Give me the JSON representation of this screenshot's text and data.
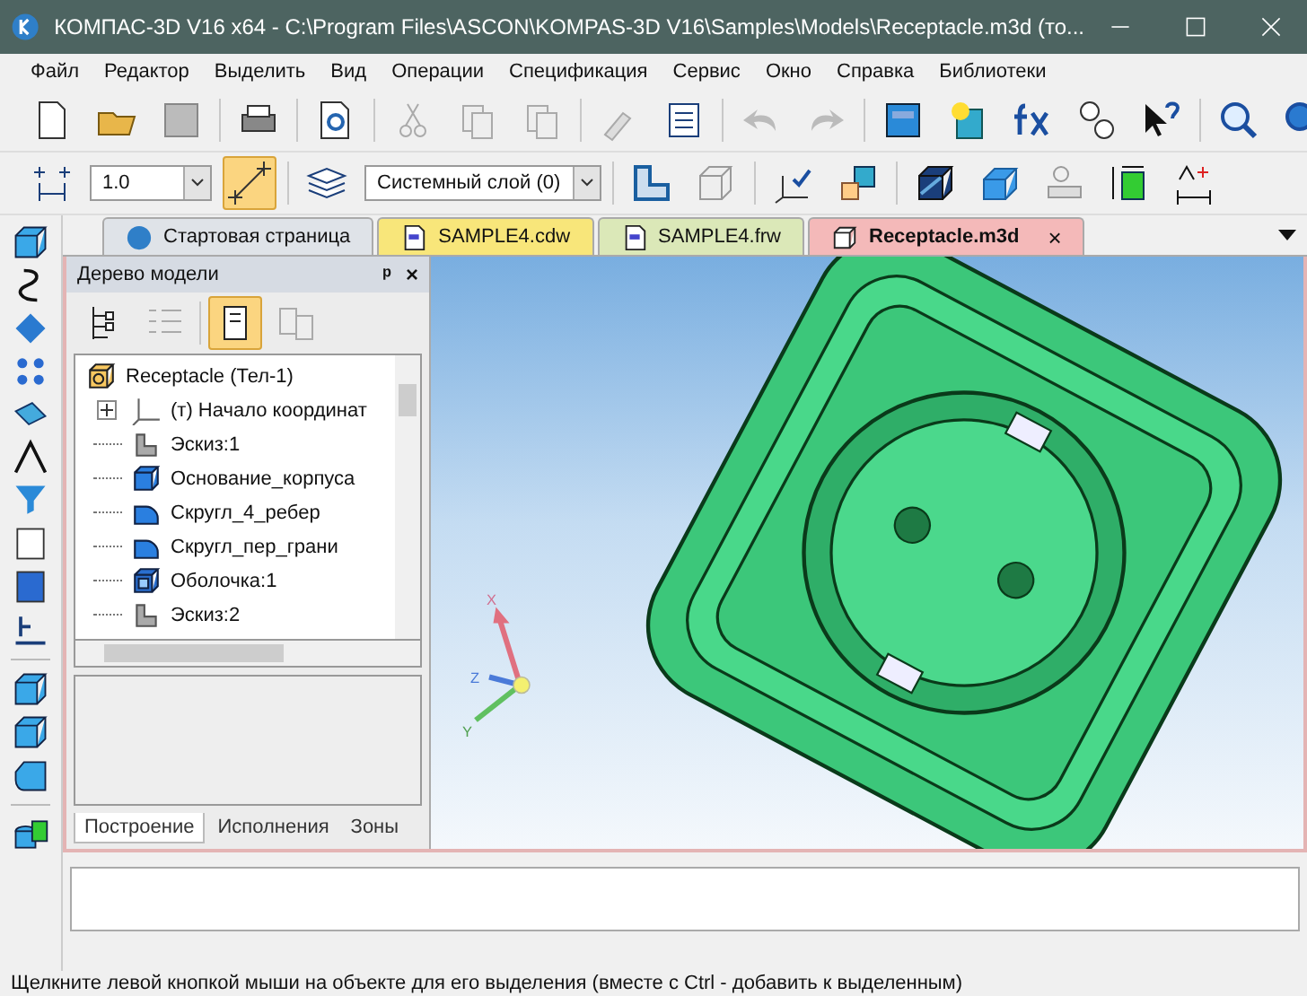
{
  "window": {
    "title": "КОМПАС-3D V16  x64 - C:\\Program Files\\ASCON\\KOMPAS-3D V16\\Samples\\Models\\Receptacle.m3d (то..."
  },
  "menu": [
    "Файл",
    "Редактор",
    "Выделить",
    "Вид",
    "Операции",
    "Спецификация",
    "Сервис",
    "Окно",
    "Справка",
    "Библиотеки"
  ],
  "toolbar": {
    "step_value": "1.0",
    "layer": "Системный слой (0)",
    "snap_selected": true
  },
  "tabs": [
    {
      "label": "Стартовая страница",
      "kind": "home",
      "selected": false
    },
    {
      "label": "SAMPLE4.cdw",
      "kind": "drawing",
      "selected": false
    },
    {
      "label": "SAMPLE4.frw",
      "kind": "fragment",
      "selected": false
    },
    {
      "label": "Receptacle.m3d",
      "kind": "model",
      "selected": true,
      "close": "×"
    }
  ],
  "tree_panel": {
    "title": "Дерево модели",
    "pin": "ᵖ",
    "close": "×",
    "structure_view_selected": true,
    "root": {
      "label": "Receptacle (Тел-1)",
      "children": [
        {
          "label": "(т) Начало координат",
          "kind": "origin",
          "expanded": false
        },
        {
          "label": "Эскиз:1",
          "kind": "sketch"
        },
        {
          "label": "Основание_корпуса",
          "kind": "extrude"
        },
        {
          "label": "Скругл_4_ребер",
          "kind": "fillet"
        },
        {
          "label": "Скругл_пер_грани",
          "kind": "fillet"
        },
        {
          "label": "Оболочка:1",
          "kind": "shell"
        },
        {
          "label": "Эскиз:2",
          "kind": "sketch"
        }
      ]
    },
    "tabs": [
      {
        "label": "Построение",
        "selected": true
      },
      {
        "label": "Исполнения",
        "selected": false
      },
      {
        "label": "Зоны",
        "selected": false
      }
    ]
  },
  "viewport": {
    "axes": [
      "X",
      "Y",
      "Z"
    ]
  },
  "status_bar": "Щелкните левой кнопкой мыши на объекте для его выделения (вместе с Ctrl - добавить к выделенным)"
}
